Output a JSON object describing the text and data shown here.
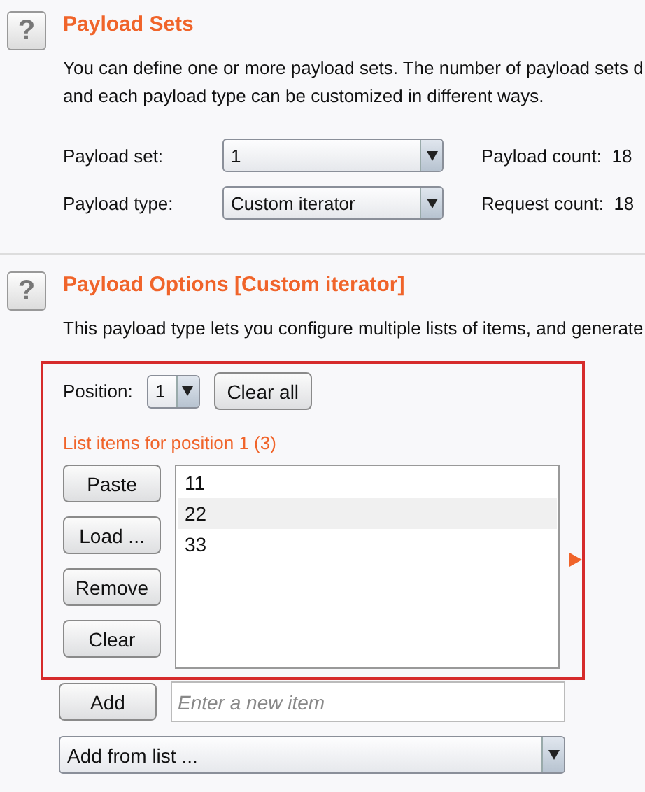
{
  "payload_sets": {
    "help": "?",
    "title": "Payload Sets",
    "description_lines": [
      "You can define one or more payload sets. The number of payload sets d",
      "and each payload type can be customized in different ways."
    ],
    "fields": [
      {
        "label": "Payload set:",
        "value": "1",
        "count_label": "Payload count:",
        "count": "18"
      },
      {
        "label": "Payload type:",
        "value": "Custom iterator",
        "count_label": "Request count:",
        "count": "18"
      }
    ]
  },
  "payload_options": {
    "help": "?",
    "title": "Payload Options [Custom iterator]",
    "description": "This payload type lets you configure multiple lists of items, and generate",
    "position_label": "Position:",
    "position_value": "1",
    "clear_all": "Clear all",
    "list_heading": "List items for position 1 (3)",
    "buttons": [
      "Paste",
      "Load ...",
      "Remove",
      "Clear"
    ],
    "items": [
      {
        "text": "11",
        "selected": false
      },
      {
        "text": "22",
        "selected": true
      },
      {
        "text": "33",
        "selected": false
      }
    ],
    "add_button": "Add",
    "new_item": {
      "placeholder": "Enter a new item"
    },
    "add_from_list": "Add from list ..."
  }
}
